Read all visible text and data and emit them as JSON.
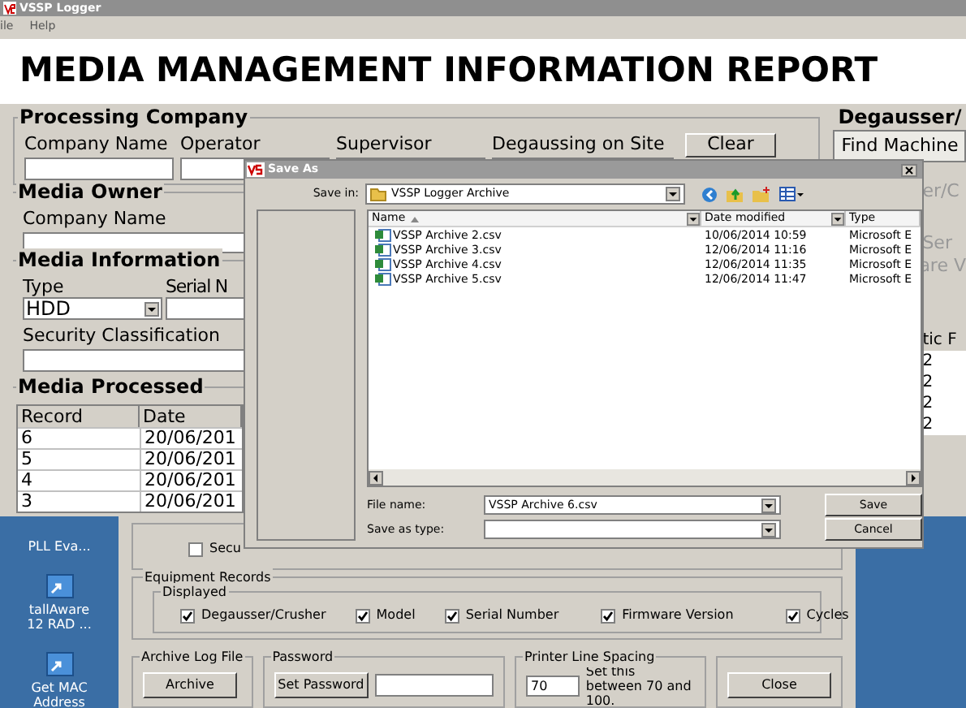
{
  "main_window": {
    "title": "VSSP Logger",
    "menu": [
      "ile",
      "Help"
    ],
    "heading": "MEDIA MANAGEMENT INFORMATION REPORT",
    "processing_company": {
      "title": "Processing Company",
      "fields": [
        {
          "label": "Company Name"
        },
        {
          "label": "Operator"
        },
        {
          "label": "Supervisor"
        },
        {
          "label": "Degaussing on Site"
        }
      ],
      "clear_button": "Clear"
    },
    "media_owner": {
      "title": "Media Owner",
      "label": "Company Name"
    },
    "media_information": {
      "title": "Media Information",
      "type_label": "Type",
      "type_value": "HDD",
      "serial_label": "Serial N",
      "security_label": "Security Classification"
    },
    "media_processed": {
      "title": "Media Processed",
      "columns": [
        "Record",
        "Date"
      ],
      "rows": [
        [
          "6",
          "20/06/201"
        ],
        [
          "5",
          "20/06/201"
        ],
        [
          "4",
          "20/06/201"
        ],
        [
          "3",
          "20/06/201"
        ]
      ]
    },
    "degausser": {
      "title": "Degausser/",
      "find_button": "Find Machine",
      "fragments": [
        "er/C",
        "Ser",
        "are V"
      ],
      "table_header": "tic F",
      "rows": [
        "2",
        "2",
        "2",
        "2"
      ]
    }
  },
  "desktop_icons": [
    {
      "lines": [
        "PLL Eva..."
      ]
    },
    {
      "lines": [
        "tallAware",
        "12 RAD ..."
      ]
    },
    {
      "lines": [
        "Get MAC",
        "Address"
      ]
    }
  ],
  "settings_window": {
    "security_checkbox": {
      "label": "Secu",
      "checked": false
    },
    "equipment_records": {
      "title": "Equipment Records",
      "displayed": {
        "title": "Displayed",
        "options": [
          {
            "label": "Degausser/Crusher",
            "checked": true
          },
          {
            "label": "Model",
            "checked": true
          },
          {
            "label": "Serial Number",
            "checked": true
          },
          {
            "label": "Firmware Version",
            "checked": true
          },
          {
            "label": "Cycles",
            "checked": true
          }
        ]
      }
    },
    "archive": {
      "title": "Archive Log File",
      "button": "Archive"
    },
    "password": {
      "title": "Password",
      "button": "Set Password"
    },
    "printer_line_spacing": {
      "title": "Printer Line Spacing",
      "value": "70",
      "hint": "Set this between 70 and 100."
    },
    "close_button": "Close"
  },
  "save_dialog": {
    "title": "Save As",
    "save_in_label": "Save in:",
    "save_in_value": "VSSP Logger Archive",
    "columns": [
      "Name",
      "Date modified",
      "Type"
    ],
    "files": [
      {
        "name": "VSSP Archive 2.csv",
        "date": "10/06/2014 10:59",
        "type": "Microsoft E"
      },
      {
        "name": "VSSP Archive 3.csv",
        "date": "12/06/2014 11:16",
        "type": "Microsoft E"
      },
      {
        "name": "VSSP Archive 4.csv",
        "date": "12/06/2014 11:35",
        "type": "Microsoft E"
      },
      {
        "name": "VSSP Archive 5.csv",
        "date": "12/06/2014 11:47",
        "type": "Microsoft E"
      }
    ],
    "file_name_label": "File name:",
    "file_name_value": "VSSP Archive 6.csv",
    "save_as_type_label": "Save as type:",
    "save_button": "Save",
    "cancel_button": "Cancel"
  }
}
